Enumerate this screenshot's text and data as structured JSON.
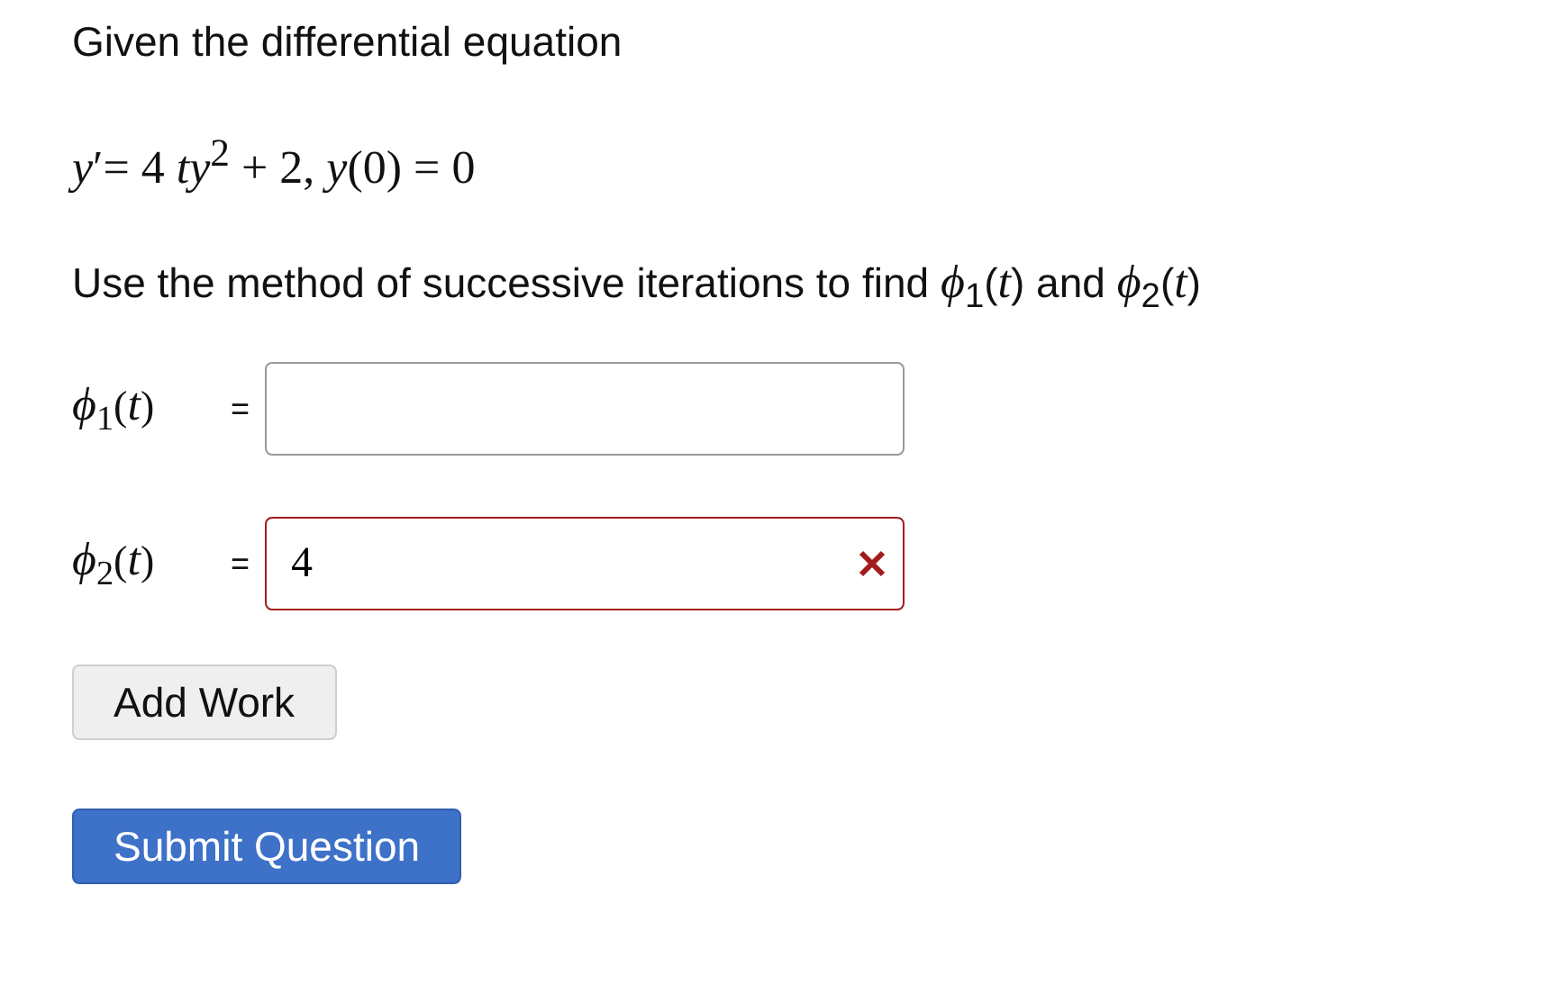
{
  "prompt": "Given the differential equation",
  "equation": "*y*′= 4 *ty*$^{2}$ + 2,  *y*(0) = 0",
  "instruction": "Use the method of successive iterations to find *ϕ*$_{1}$(*t*) and *ϕ*$_{2}$(*t*)",
  "answers": [
    {
      "label": "*ϕ*$_{1}$(*t*)",
      "equals": "=",
      "incorrect": false
    },
    {
      "label": "*ϕ*$_{2}$(*t*)",
      "equals": "=",
      "value": "4",
      "incorrect": true
    }
  ],
  "buttons": [
    {
      "label": "Add Work",
      "kind": "secondary"
    },
    {
      "label": "Submit Question",
      "kind": "primary"
    }
  ]
}
